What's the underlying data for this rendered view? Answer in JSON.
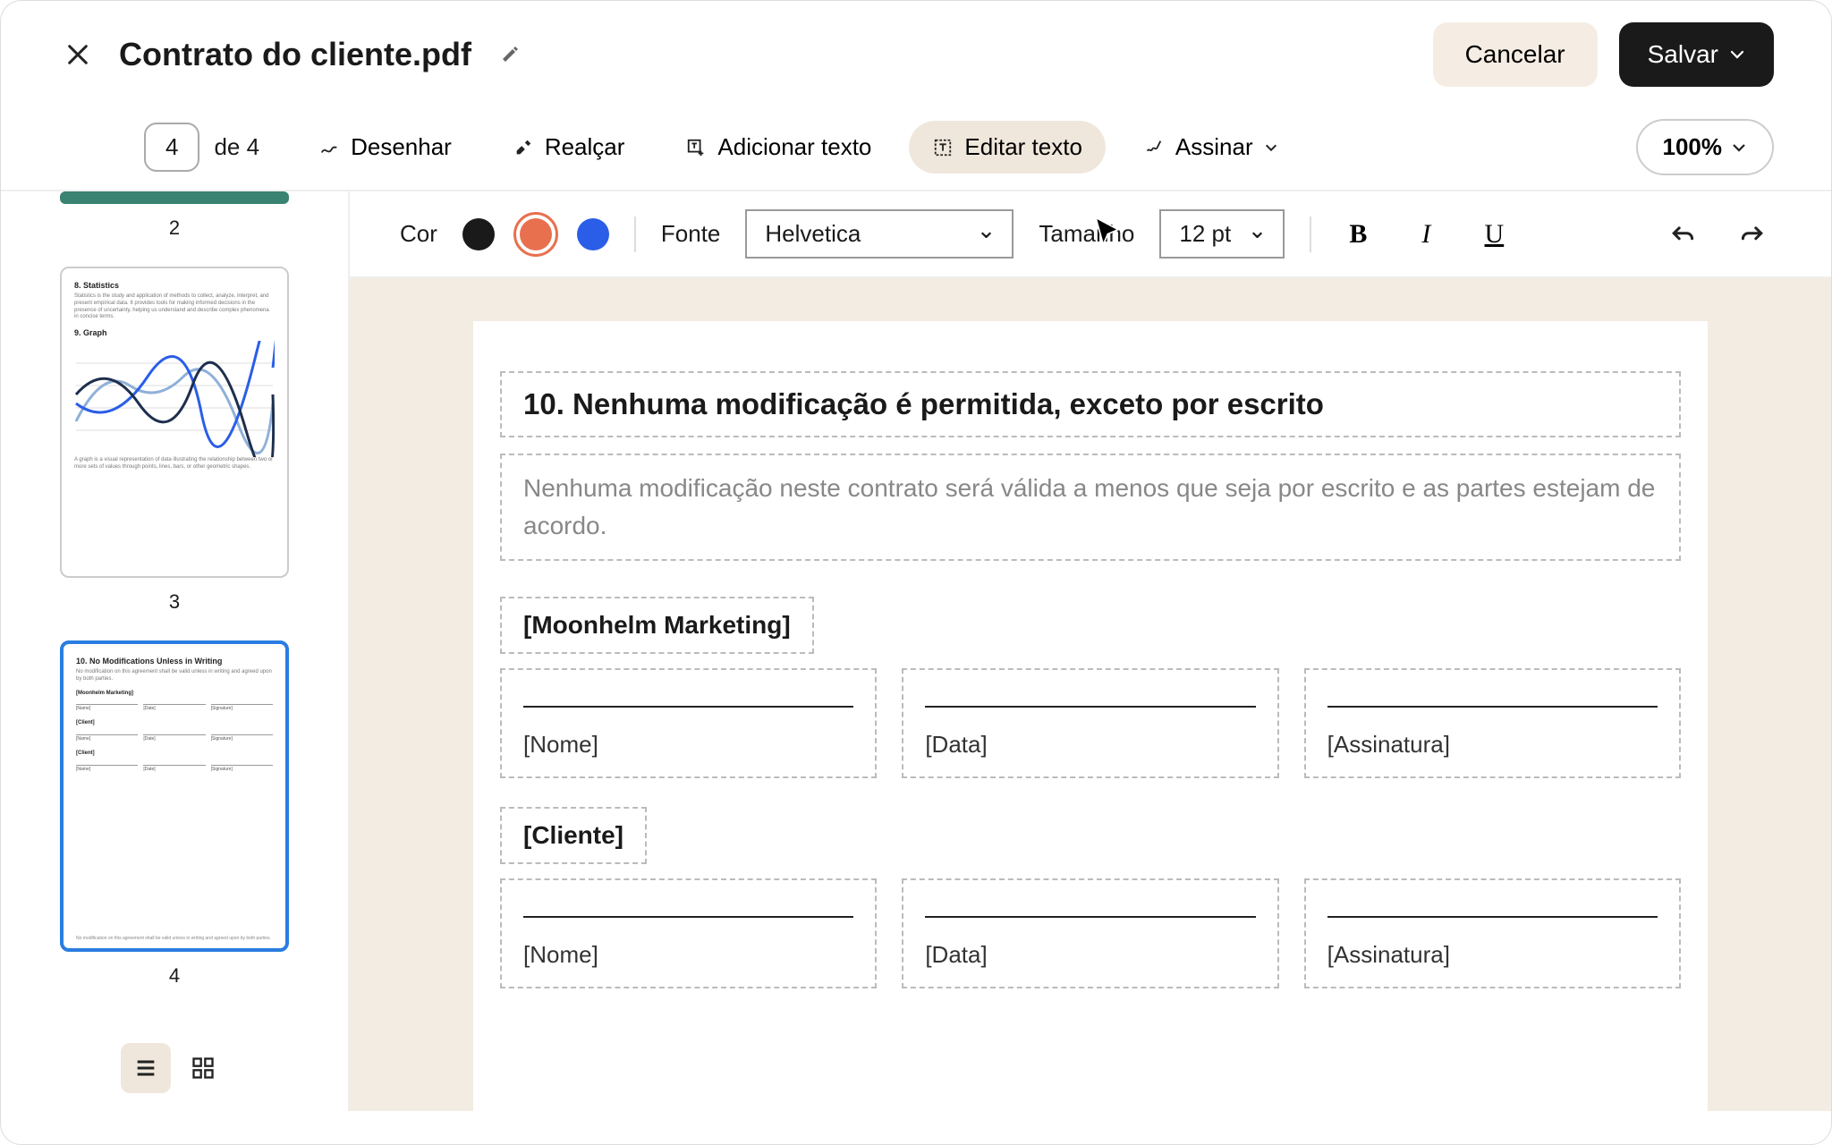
{
  "header": {
    "title": "Contrato do cliente.pdf",
    "cancel_label": "Cancelar",
    "save_label": "Salvar"
  },
  "toolbar": {
    "page_current": "4",
    "page_of": "de 4",
    "draw": "Desenhar",
    "highlight": "Realçar",
    "add_text": "Adicionar texto",
    "edit_text": "Editar texto",
    "sign": "Assinar",
    "zoom": "100%"
  },
  "format": {
    "color_label": "Cor",
    "colors": {
      "black": "#1a1a1a",
      "orange": "#e8704f",
      "blue": "#2a5ee8"
    },
    "selected_color": "orange",
    "font_label": "Fonte",
    "font_value": "Helvetica",
    "size_label": "Tamanho",
    "size_value": "12 pt"
  },
  "thumbs": {
    "p2_label": "2",
    "p3_label": "3",
    "p4_label": "4",
    "p3": {
      "h1": "8. Statistics",
      "t1": "Statistics is the study and application of methods to collect, analyze, interpret, and present empirical data. It provides tools for making informed decisions in the presence of uncertainty, helping us understand and describe complex phenomena in concise terms.",
      "h2": "9. Graph",
      "t2": "A graph is a visual representation of data illustrating the relationship between two or more sets of values through points, lines, bars, or other geometric shapes."
    },
    "p4": {
      "h1": "10. No Modifications Unless in Writing",
      "t1": "No modification on this agreement shall be valid unless in writing and agreed upon by both parties.",
      "party1": "[Moonhelm Marketing]",
      "party2": "[Client]",
      "name": "[Name]",
      "date": "[Date]",
      "sig": "[Signature]",
      "footer": "No modification on this agreement shall be valid unless in writing and agreed upon by both parties."
    }
  },
  "document": {
    "section_title": "10. Nenhuma modificação é permitida, exceto por escrito",
    "section_body": "Nenhuma modificação neste contrato será válida a menos que seja por escrito e as partes estejam de acordo.",
    "party1": "[Moonhelm Marketing]",
    "party2": "[Cliente]",
    "field_name": "[Nome]",
    "field_date": "[Data]",
    "field_signature": "[Assinatura]"
  }
}
